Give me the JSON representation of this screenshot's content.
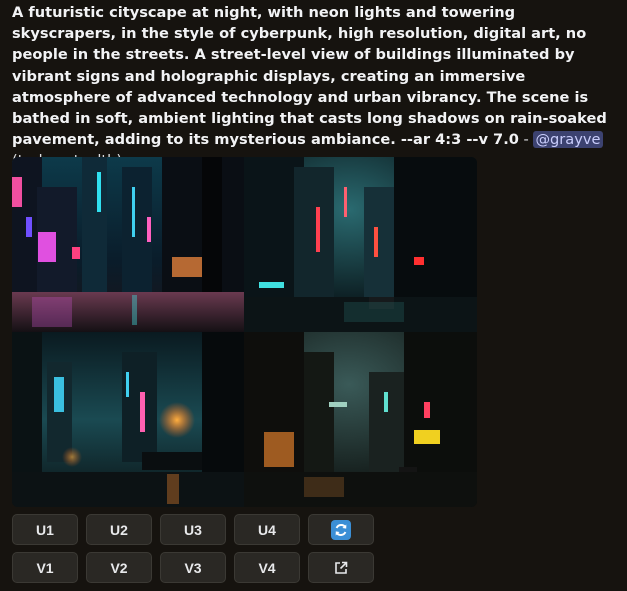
{
  "message": {
    "prompt": "A futuristic cityscape at night, with neon lights and towering skyscrapers, in the style of cyberpunk, high resolution, digital art, no people in the streets. A street-level view of buildings illuminated by vibrant signs and holographic displays, creating an immersive atmosphere of advanced technology and urban vibrancy. The scene is bathed in soft, ambient lighting that casts long shadows on rain-soaked pavement, adding to its mysterious ambiance. --ar 4:3 --v 7.0",
    "separator": " - ",
    "mention": "@grayve",
    "suffix": " (turbo, stealth)"
  },
  "images": [
    {
      "name": "image-1",
      "palette": [
        "#0b2a3a",
        "#e84fd0",
        "#1fd3e0"
      ]
    },
    {
      "name": "image-2",
      "palette": [
        "#0a1a20",
        "#ff4a3a",
        "#4fe0e0"
      ]
    },
    {
      "name": "image-3",
      "palette": [
        "#0c2630",
        "#ff8a20",
        "#3ad0e0"
      ]
    },
    {
      "name": "image-4",
      "palette": [
        "#0b1410",
        "#ffd030",
        "#50c0c0"
      ]
    }
  ],
  "buttons": {
    "upscale": [
      "U1",
      "U2",
      "U3",
      "U4"
    ],
    "variation": [
      "V1",
      "V2",
      "V3",
      "V4"
    ],
    "reroll_icon": "refresh-icon",
    "share_icon": "external-link-icon"
  }
}
